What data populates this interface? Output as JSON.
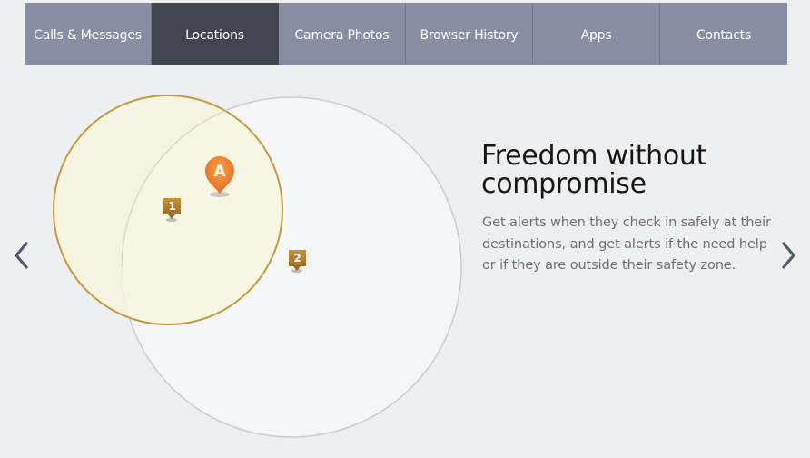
{
  "tabs": [
    {
      "label": "Calls & Messages",
      "active": false
    },
    {
      "label": "Locations",
      "active": true
    },
    {
      "label": "Camera Photos",
      "active": false
    },
    {
      "label": "Browser History",
      "active": false
    },
    {
      "label": "Apps",
      "active": false
    },
    {
      "label": "Contacts",
      "active": false
    }
  ],
  "slide": {
    "title": "Freedom without compromise",
    "description": "Get alerts when they check in safely at their destinations, and get alerts if the need help or if they are outside their safety zone."
  },
  "markers": {
    "a_label": "A",
    "pin1_label": "1",
    "pin2_label": "2"
  },
  "colors": {
    "tab_bar": "#878ea3",
    "tab_active": "#3f4650",
    "zone_fill": "#f7f7e5",
    "zone_border": "#c39a3e",
    "marker_a": "#e9742e",
    "marker_pin": "#b07e2a"
  },
  "icons": {
    "prev": "chevron-left-icon",
    "next": "chevron-right-icon",
    "marker_a": "location-marker-icon",
    "pin": "map-pin-icon"
  }
}
